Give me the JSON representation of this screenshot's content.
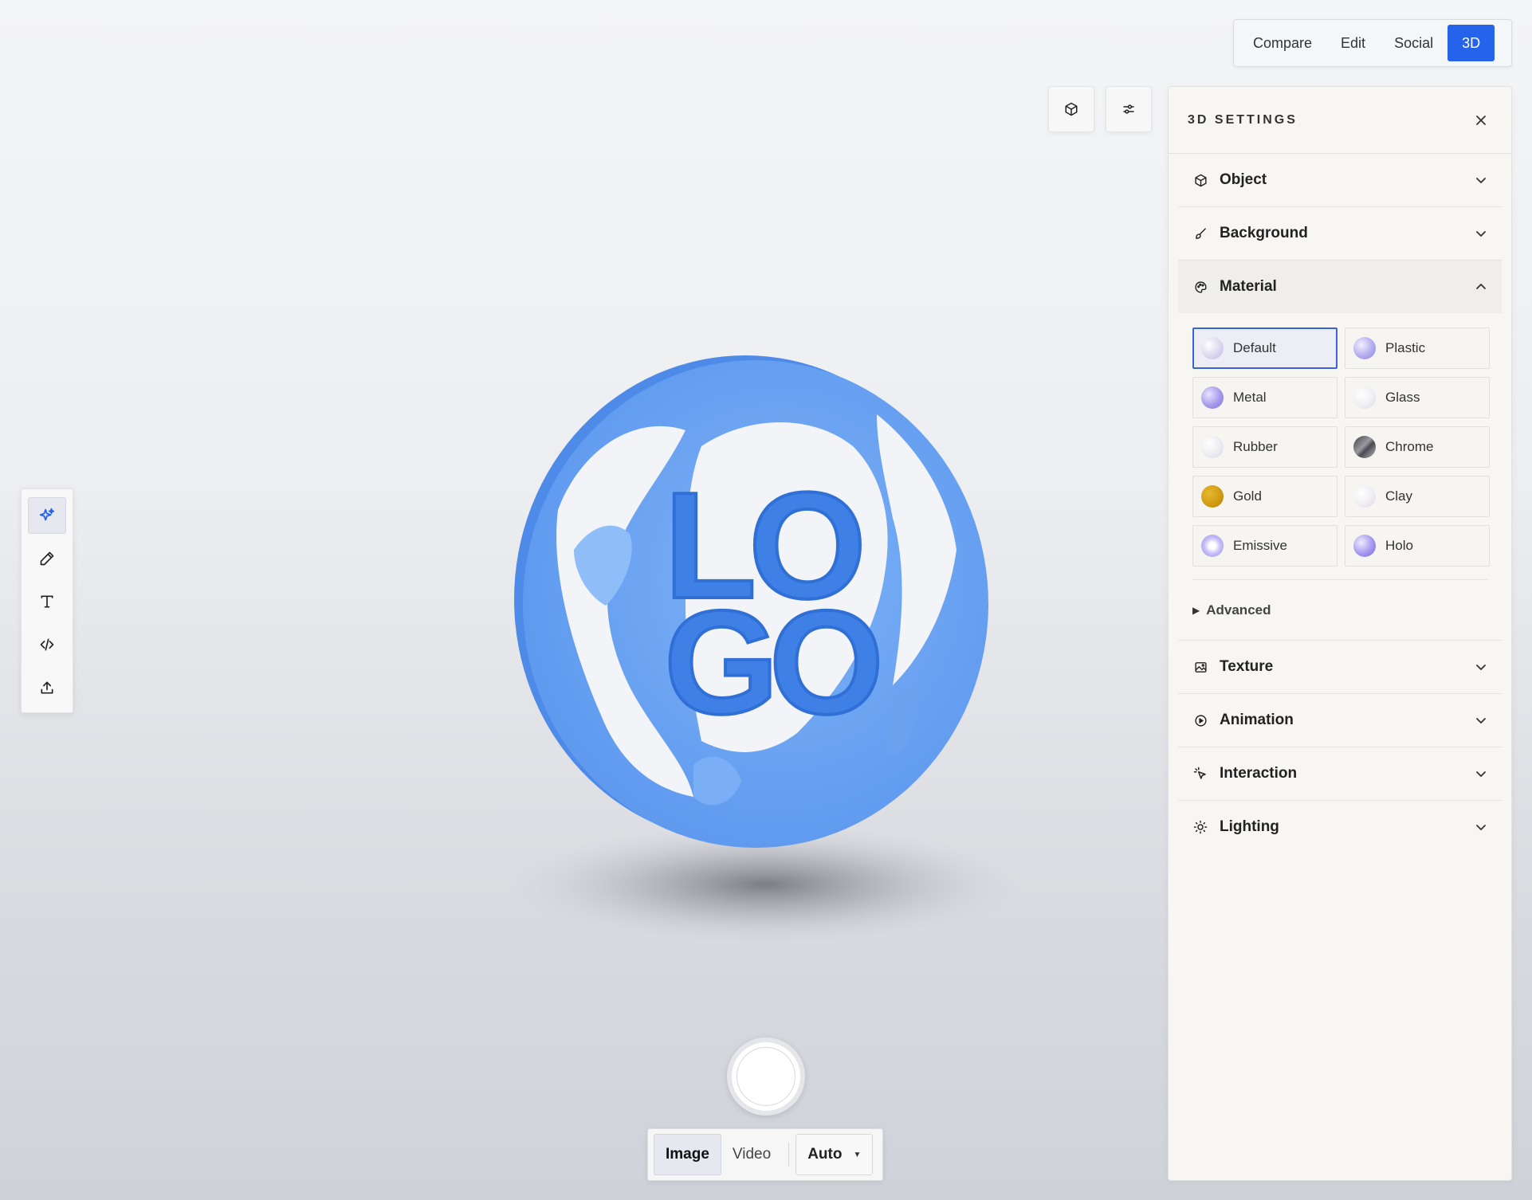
{
  "mode_switch": {
    "tabs": [
      {
        "label": "Compare"
      },
      {
        "label": "Edit"
      },
      {
        "label": "Social"
      },
      {
        "label": "3D",
        "active": true
      }
    ]
  },
  "float_buttons": [
    {
      "icon": "cube-icon"
    },
    {
      "icon": "sliders-icon"
    }
  ],
  "panel": {
    "title": "3D SETTINGS",
    "close_icon": "close-icon",
    "sections_top": [
      {
        "label": "Object",
        "icon": "cube-icon",
        "open": false
      },
      {
        "label": "Background",
        "icon": "brush-icon",
        "open": false
      },
      {
        "label": "Material",
        "icon": "palette-icon",
        "open": true
      }
    ],
    "materials": [
      {
        "label": "Default",
        "selected": true,
        "color": "#e6e4f2"
      },
      {
        "label": "Plastic",
        "selected": false,
        "color": "#b9b2f2"
      },
      {
        "label": "Metal",
        "selected": false,
        "color": "#a99ee8"
      },
      {
        "label": "Glass",
        "selected": false,
        "color": "#ecebf3"
      },
      {
        "label": "Rubber",
        "selected": false,
        "color": "#ecebf1"
      },
      {
        "label": "Chrome",
        "selected": false,
        "color": "#6b6b70"
      },
      {
        "label": "Gold",
        "selected": false,
        "color": "#d4a017"
      },
      {
        "label": "Clay",
        "selected": false,
        "color": "#efedf2"
      },
      {
        "label": "Emissive",
        "selected": false,
        "color": "#b8aef5"
      },
      {
        "label": "Holo",
        "selected": false,
        "color": "#a89cf0"
      }
    ],
    "advanced_label": "Advanced",
    "sections_bottom": [
      {
        "label": "Texture",
        "icon": "image-icon"
      },
      {
        "label": "Animation",
        "icon": "play-circle-icon"
      },
      {
        "label": "Interaction",
        "icon": "pointer-click-icon"
      },
      {
        "label": "Lighting",
        "icon": "sun-icon"
      }
    ]
  },
  "left_toolbar": {
    "tools": [
      {
        "icon": "sparkles-icon",
        "active": true
      },
      {
        "icon": "pencil-icon",
        "active": false
      },
      {
        "icon": "text-icon",
        "active": false
      },
      {
        "icon": "code-icon",
        "active": false
      },
      {
        "icon": "upload-icon",
        "active": false
      }
    ]
  },
  "capture": {
    "tabs": [
      {
        "label": "Image",
        "active": true
      },
      {
        "label": "Video",
        "active": false
      }
    ],
    "select_value": "Auto"
  },
  "scene": {
    "logo_line1": "LO",
    "logo_line2": "GO",
    "globe_color": "#6ea6f5"
  }
}
